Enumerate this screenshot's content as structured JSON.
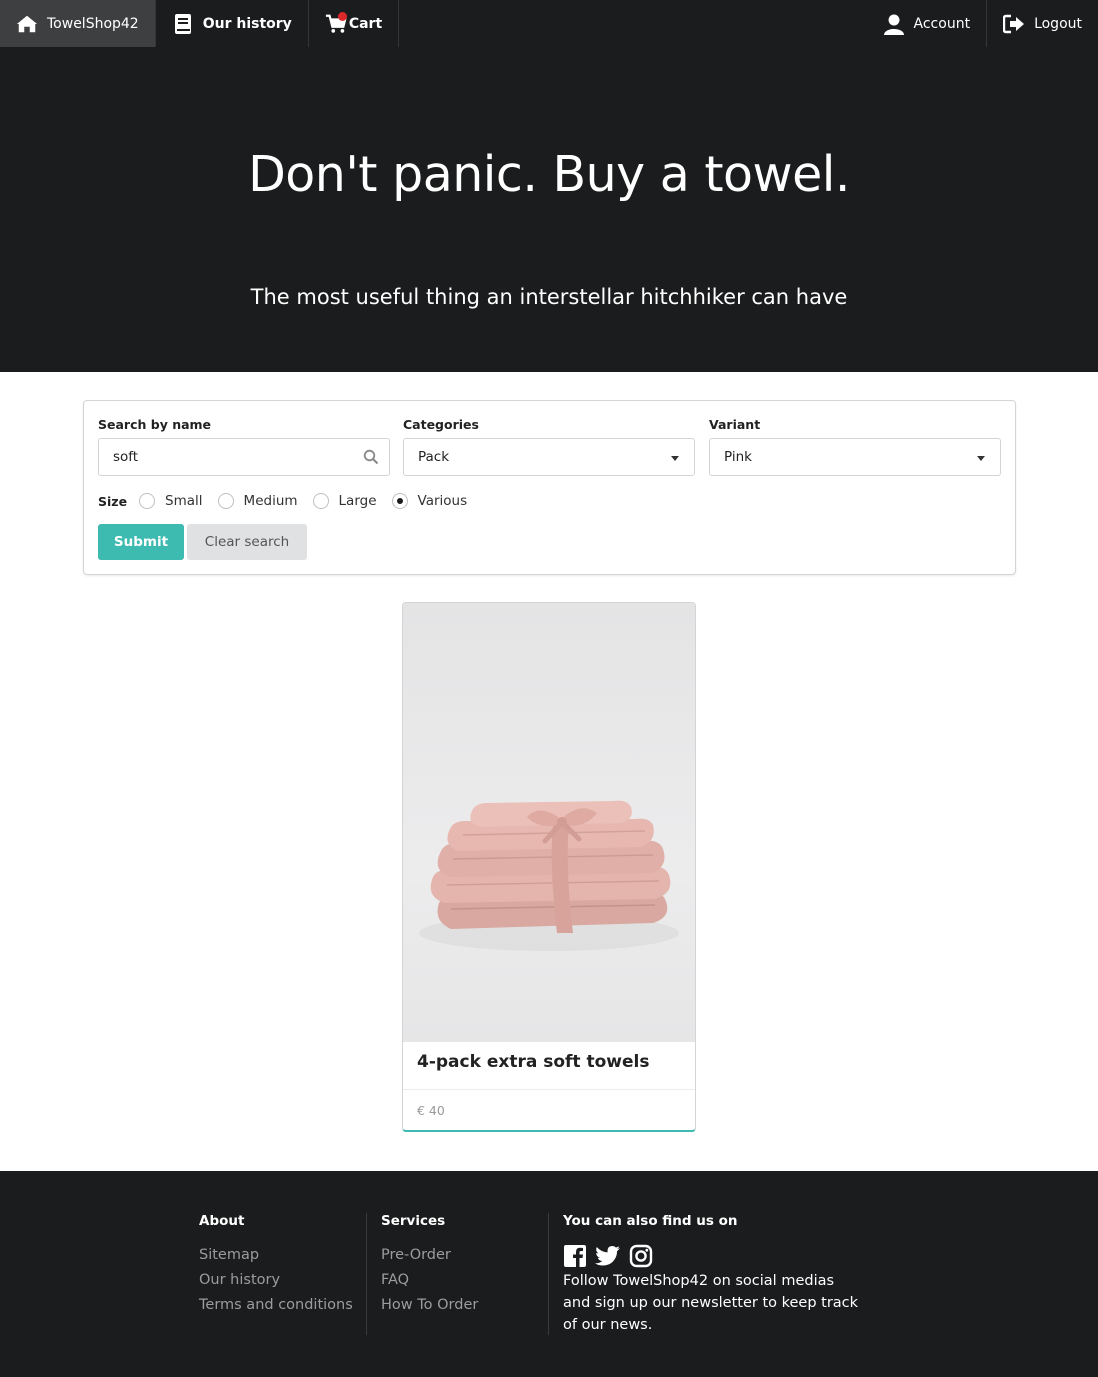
{
  "nav": {
    "brand": "TowelShop42",
    "history": "Our history",
    "cart": "Cart",
    "account": "Account",
    "logout": "Logout",
    "icons": [
      "home-icon",
      "book-icon",
      "cart-icon",
      "user-icon",
      "logout-icon"
    ],
    "cart_badge_color": "#db2828"
  },
  "hero": {
    "title": "Don't panic. Buy a towel.",
    "subtitle": "The most useful thing an interstellar hitchhiker can have"
  },
  "search": {
    "name_label": "Search by name",
    "name_value": "soft",
    "categories_label": "Categories",
    "categories_value": "Pack",
    "variant_label": "Variant",
    "variant_value": "Pink",
    "size_label": "Size",
    "sizes": [
      {
        "label": "Small",
        "checked": false
      },
      {
        "label": "Medium",
        "checked": false
      },
      {
        "label": "Large",
        "checked": false
      },
      {
        "label": "Various",
        "checked": true
      }
    ],
    "submit": "Submit",
    "clear": "Clear search"
  },
  "product": {
    "name": "4-pack extra soft towels",
    "price": "€ 40",
    "accent": "#3ebbb1"
  },
  "footer": {
    "about_title": "About",
    "about_links": [
      "Sitemap",
      "Our history",
      "Terms and conditions"
    ],
    "services_title": "Services",
    "services_links": [
      "Pre-Order",
      "FAQ",
      "How To Order"
    ],
    "social_title": "You can also find us on",
    "social_icons": [
      "facebook-icon",
      "twitter-icon",
      "instagram-icon"
    ],
    "follow_text": "Follow TowelShop42 on social medias and sign up our newsletter to keep track of our news."
  }
}
